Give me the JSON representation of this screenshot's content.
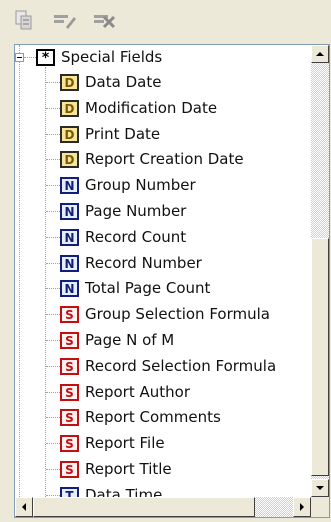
{
  "toolbar": {
    "buttons": [
      {
        "icon": "insert-field-icon"
      },
      {
        "icon": "edit-field-icon"
      },
      {
        "icon": "delete-field-icon"
      }
    ]
  },
  "tree": {
    "root": {
      "label": "Special Fields",
      "icon_glyph": "*",
      "expanded": true
    },
    "items": [
      {
        "label": "Data Date",
        "glyph": "D",
        "kind": "d"
      },
      {
        "label": "Modification Date",
        "glyph": "D",
        "kind": "d"
      },
      {
        "label": "Print Date",
        "glyph": "D",
        "kind": "d"
      },
      {
        "label": "Report Creation Date",
        "glyph": "D",
        "kind": "d"
      },
      {
        "label": "Group Number",
        "glyph": "N",
        "kind": "n"
      },
      {
        "label": "Page Number",
        "glyph": "N",
        "kind": "n"
      },
      {
        "label": "Record Count",
        "glyph": "N",
        "kind": "n"
      },
      {
        "label": "Record Number",
        "glyph": "N",
        "kind": "n"
      },
      {
        "label": "Total Page Count",
        "glyph": "N",
        "kind": "n"
      },
      {
        "label": "Group Selection Formula",
        "glyph": "S",
        "kind": "s"
      },
      {
        "label": "Page N of M",
        "glyph": "S",
        "kind": "s"
      },
      {
        "label": "Record Selection Formula",
        "glyph": "S",
        "kind": "s"
      },
      {
        "label": "Report Author",
        "glyph": "S",
        "kind": "s"
      },
      {
        "label": "Report Comments",
        "glyph": "S",
        "kind": "s"
      },
      {
        "label": "Report File",
        "glyph": "S",
        "kind": "s"
      },
      {
        "label": "Report Title",
        "glyph": "S",
        "kind": "s"
      },
      {
        "label": "Data Time",
        "glyph": "T",
        "kind": "t"
      }
    ]
  },
  "colors": {
    "window_bg": "#ece9d8",
    "tree_bg": "#ffffff",
    "date_icon_fill": "#f7e59a",
    "number_icon_border": "#10207a",
    "string_icon_border": "#c01010"
  }
}
